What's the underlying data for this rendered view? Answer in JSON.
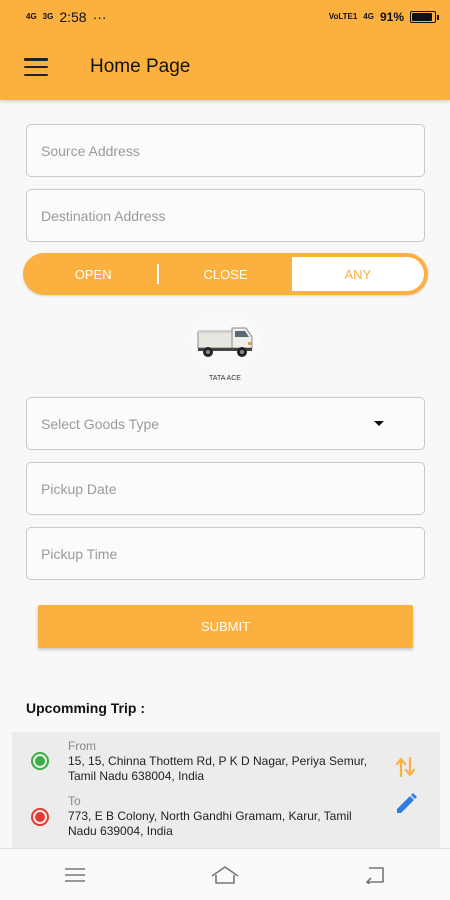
{
  "status_bar": {
    "signal_left_1": "4G",
    "signal_left_2": "3G",
    "time": "2:58",
    "extra": "···",
    "network": "VoLTE1",
    "signal_right": "4G",
    "battery_text": "91%",
    "battery_level": 0.91
  },
  "app_bar": {
    "title": "Home Page"
  },
  "form": {
    "source_placeholder": "Source Address",
    "destination_placeholder": "Destination Address",
    "goods_type_label": "Select Goods Type",
    "pickup_date_placeholder": "Pickup Date",
    "pickup_time_placeholder": "Pickup Time",
    "submit_label": "SUBMIT"
  },
  "segment": {
    "options": [
      "OPEN",
      "CLOSE",
      "ANY"
    ],
    "selected": "ANY"
  },
  "vehicle": {
    "label": "TATA ACE"
  },
  "upcoming": {
    "title": "Upcomming Trip :",
    "from_label": "From",
    "from_address": "15, 15, Chinna Thottem Rd, P K D Nagar, Periya Semur, Tamil Nadu 638004, India",
    "to_label": "To",
    "to_address": "773, E B Colony, North Gandhi Gramam, Karur, Tamil Nadu 639004, India"
  },
  "colors": {
    "accent": "#fbb040",
    "from_dot": "#3fae49",
    "to_dot": "#e53935",
    "edit_icon": "#2f7de1"
  },
  "icons": {
    "menu": "hamburger-menu-icon",
    "swap": "swap-vertical-icon",
    "edit": "pencil-icon",
    "nav_menu": "nav-menu-icon",
    "nav_home": "nav-home-icon",
    "nav_back": "nav-back-icon"
  }
}
